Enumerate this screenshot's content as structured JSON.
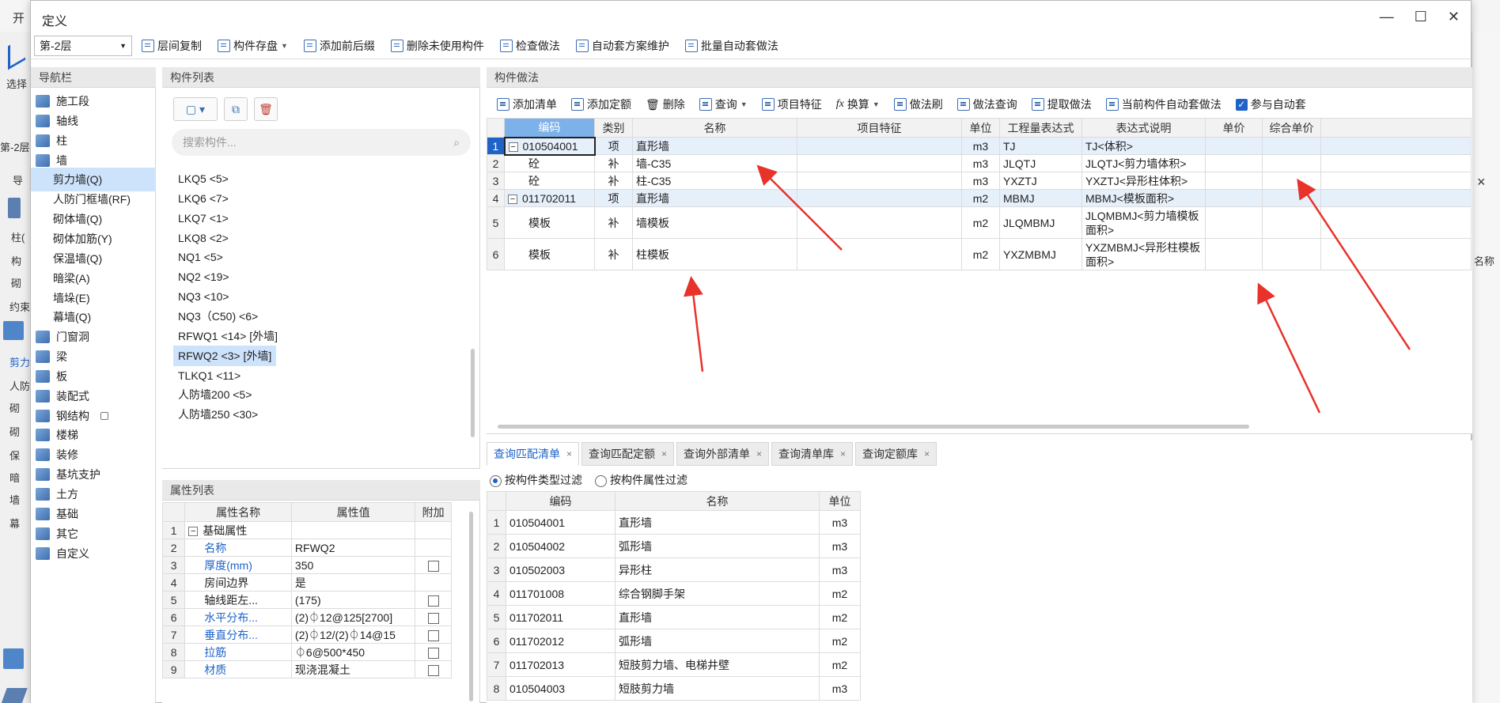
{
  "background": {
    "top_label": "开",
    "left_texts": [
      "选择",
      "第-2层",
      "导",
      "柱(",
      "构",
      "砌",
      "约束",
      "剪力",
      "人防",
      "砌",
      "砌",
      "保",
      "暗",
      "墙",
      "幕"
    ],
    "right_text": "名称",
    "right_close": "×"
  },
  "dialog": {
    "title": "定义",
    "controls": {
      "minimize": "—",
      "maximize": "☐",
      "close": "✕"
    }
  },
  "toolbar": {
    "floor": "第-2层",
    "buttons": [
      "层间复制",
      "构件存盘",
      "添加前后缀",
      "删除未使用构件",
      "检查做法",
      "自动套方案维护",
      "批量自动套做法"
    ]
  },
  "nav": {
    "title": "导航栏",
    "items": [
      {
        "label": "施工段",
        "level": 0
      },
      {
        "label": "轴线",
        "level": 0
      },
      {
        "label": "柱",
        "level": 0
      },
      {
        "label": "墙",
        "level": 0
      },
      {
        "label": "剪力墙(Q)",
        "level": 1,
        "selected": true
      },
      {
        "label": "人防门框墙(RF)",
        "level": 1
      },
      {
        "label": "砌体墙(Q)",
        "level": 1
      },
      {
        "label": "砌体加筋(Y)",
        "level": 1
      },
      {
        "label": "保温墙(Q)",
        "level": 1
      },
      {
        "label": "暗梁(A)",
        "level": 1
      },
      {
        "label": "墙垛(E)",
        "level": 1
      },
      {
        "label": "幕墙(Q)",
        "level": 1
      },
      {
        "label": "门窗洞",
        "level": 0
      },
      {
        "label": "梁",
        "level": 0
      },
      {
        "label": "板",
        "level": 0
      },
      {
        "label": "装配式",
        "level": 0
      },
      {
        "label": "钢结构",
        "level": 0,
        "locked": true
      },
      {
        "label": "楼梯",
        "level": 0
      },
      {
        "label": "装修",
        "level": 0
      },
      {
        "label": "基坑支护",
        "level": 0
      },
      {
        "label": "土方",
        "level": 0
      },
      {
        "label": "基础",
        "level": 0
      },
      {
        "label": "其它",
        "level": 0
      },
      {
        "label": "自定义",
        "level": 0
      }
    ]
  },
  "components": {
    "title": "构件列表",
    "search_placeholder": "搜索构件...",
    "items": [
      "LKQ5 <5>",
      "LKQ6 <7>",
      "LKQ7 <1>",
      "LKQ8 <2>",
      "NQ1 <5>",
      "NQ2 <19>",
      "NQ3 <10>",
      "NQ3（C50) <6>",
      "RFWQ1 <14> [外墙]",
      "RFWQ2 <3> [外墙]",
      "TLKQ1 <11>",
      "人防墙200 <5>",
      "人防墙250 <30>"
    ],
    "selected_index": 9
  },
  "properties": {
    "title": "属性列表",
    "headers": [
      "属性名称",
      "属性值",
      "附加"
    ],
    "rows": [
      {
        "n": "1",
        "name": "基础属性",
        "value": "",
        "group": true
      },
      {
        "n": "2",
        "name": "名称",
        "value": "RFWQ2",
        "blue": true,
        "check": false
      },
      {
        "n": "3",
        "name": "厚度(mm)",
        "value": "350",
        "blue": true,
        "check": true
      },
      {
        "n": "4",
        "name": "房间边界",
        "value": "是",
        "check": false
      },
      {
        "n": "5",
        "name": "轴线距左...",
        "value": "(175)",
        "check": true
      },
      {
        "n": "6",
        "name": "水平分布...",
        "value": "(2)⏀12@125[2700]",
        "blue": true,
        "check": true
      },
      {
        "n": "7",
        "name": "垂直分布...",
        "value": "(2)⏀12/(2)⏀14@15",
        "blue": true,
        "check": true
      },
      {
        "n": "8",
        "name": "拉筋",
        "value": "⏀6@500*450",
        "blue": true,
        "check": true
      },
      {
        "n": "9",
        "name": "材质",
        "value": "现浇混凝土",
        "blue": true,
        "check": true
      }
    ]
  },
  "method": {
    "title": "构件做法",
    "tools": [
      "添加清单",
      "添加定额",
      "删除",
      "查询",
      "项目特征",
      "换算",
      "做法刷",
      "做法查询",
      "提取做法",
      "当前构件自动套做法",
      "参与自动套"
    ],
    "headers": [
      "编码",
      "类别",
      "名称",
      "项目特征",
      "单位",
      "工程量表达式",
      "表达式说明",
      "单价",
      "综合单价"
    ],
    "rows": [
      {
        "n": "1",
        "code": "010504001",
        "cat": "项",
        "name": "直形墙",
        "feat": "",
        "unit": "m3",
        "expr": "TJ",
        "desc": "TJ<体积>",
        "parent": true
      },
      {
        "n": "2",
        "code": "砼",
        "cat": "补",
        "name": "墙-C35",
        "feat": "",
        "unit": "m3",
        "expr": "JLQTJ",
        "desc": "JLQTJ<剪力墙体积>",
        "parent": false
      },
      {
        "n": "3",
        "code": "砼",
        "cat": "补",
        "name": "柱-C35",
        "feat": "",
        "unit": "m3",
        "expr": "YXZTJ",
        "desc": "YXZTJ<异形柱体积>",
        "parent": false
      },
      {
        "n": "4",
        "code": "011702011",
        "cat": "项",
        "name": "直形墙",
        "feat": "",
        "unit": "m2",
        "expr": "MBMJ",
        "desc": "MBMJ<模板面积>",
        "parent": true
      },
      {
        "n": "5",
        "code": "模板",
        "cat": "补",
        "name": "墙模板",
        "feat": "",
        "unit": "m2",
        "expr": "JLQMBMJ",
        "desc": "JLQMBMJ<剪力墙模板面积>",
        "parent": false,
        "tall": true
      },
      {
        "n": "6",
        "code": "模板",
        "cat": "补",
        "name": "柱模板",
        "feat": "",
        "unit": "m2",
        "expr": "YXZMBMJ",
        "desc": "YXZMBMJ<异形柱模板面积>",
        "parent": false,
        "tall": true
      }
    ]
  },
  "query": {
    "tabs": [
      "查询匹配清单",
      "查询匹配定额",
      "查询外部清单",
      "查询清单库",
      "查询定额库"
    ],
    "filters": [
      "按构件类型过滤",
      "按构件属性过滤"
    ],
    "headers": [
      "编码",
      "名称",
      "单位"
    ],
    "rows": [
      {
        "n": "1",
        "code": "010504001",
        "name": "直形墙",
        "unit": "m3"
      },
      {
        "n": "2",
        "code": "010504002",
        "name": "弧形墙",
        "unit": "m3"
      },
      {
        "n": "3",
        "code": "010502003",
        "name": "异形柱",
        "unit": "m3"
      },
      {
        "n": "4",
        "code": "011701008",
        "name": "综合钢脚手架",
        "unit": "m2"
      },
      {
        "n": "5",
        "code": "011702011",
        "name": "直形墙",
        "unit": "m2"
      },
      {
        "n": "6",
        "code": "011702012",
        "name": "弧形墙",
        "unit": "m2"
      },
      {
        "n": "7",
        "code": "011702013",
        "name": "短肢剪力墙、电梯井壁",
        "unit": "m2"
      },
      {
        "n": "8",
        "code": "010504003",
        "name": "短肢剪力墙",
        "unit": "m3"
      }
    ]
  },
  "colors": {
    "accent": "#1f63c9",
    "selection": "#cde2fb",
    "arrow": "#e8332b"
  }
}
